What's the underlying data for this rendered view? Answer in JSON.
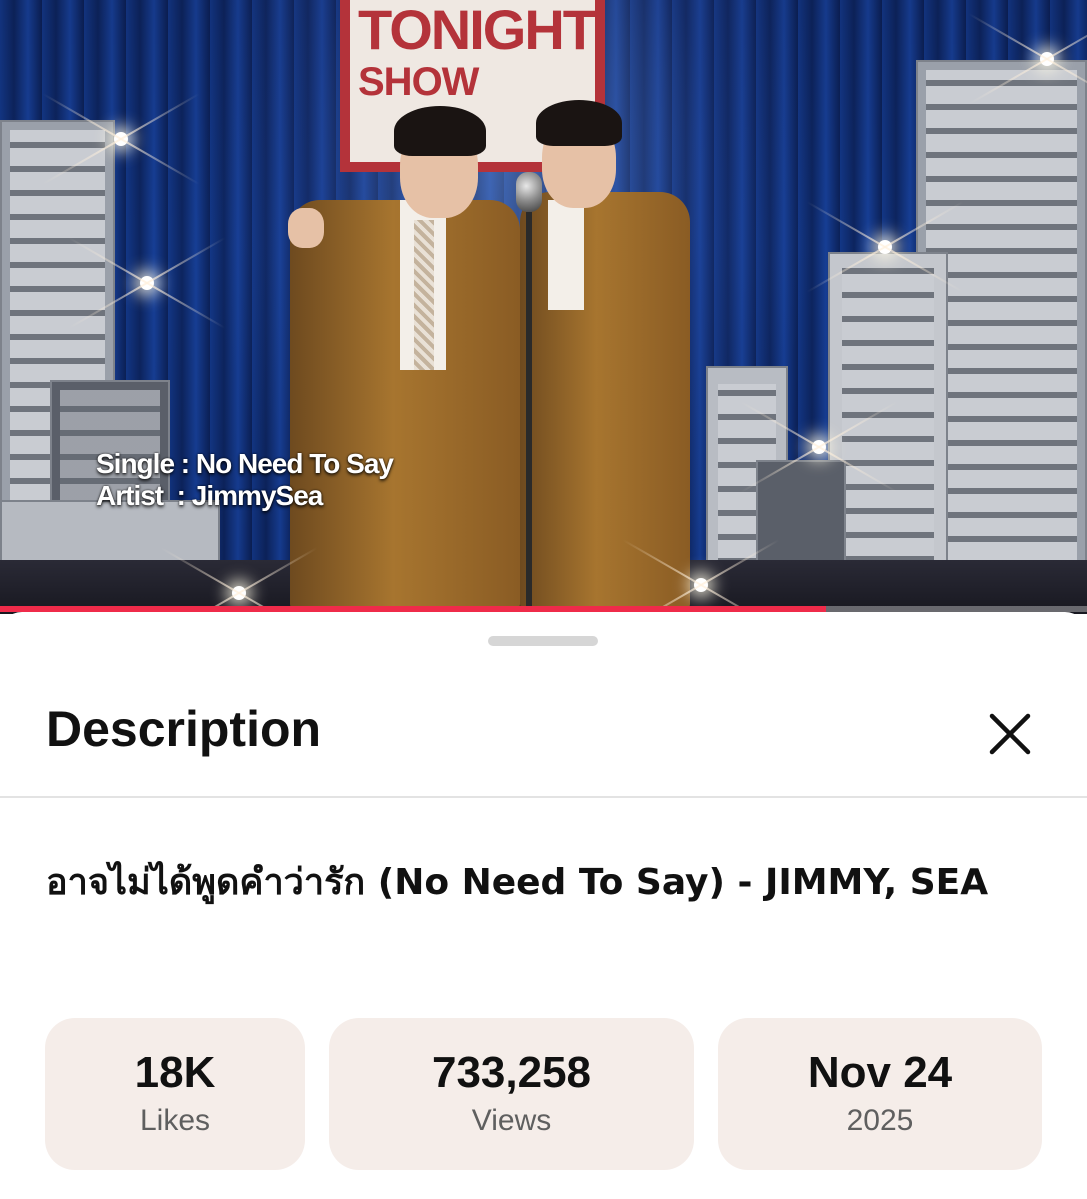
{
  "video": {
    "sign_line1": "TONIGHT",
    "sign_line2": "SHOW",
    "overlay_single_label": "Single",
    "overlay_single_value": "No Need To Say",
    "overlay_artist_label": "Artist",
    "overlay_artist_value": "JimmySea",
    "progress_fraction": 0.76,
    "progress_color": "#ef2b4a"
  },
  "sheet": {
    "header_title": "Description",
    "close_icon": "close-icon",
    "video_title": "อาจไม่ได้พูดคำว่ารัก (No Need To Say) - JIMMY, SEA",
    "stats": [
      {
        "value": "18K",
        "label": "Likes"
      },
      {
        "value": "733,258",
        "label": "Views"
      },
      {
        "value": "Nov 24",
        "label": "2025"
      }
    ],
    "stat_bg_color": "#f5ede9"
  }
}
